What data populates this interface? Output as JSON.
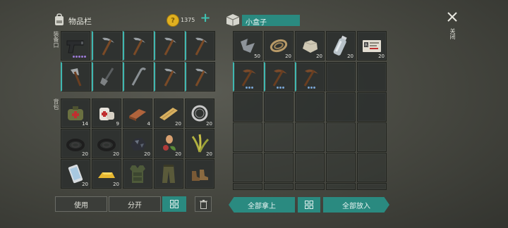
{
  "inventory": {
    "title": "物品栏",
    "coin_count": "1375",
    "add_label": "+",
    "section_equip": "装备口",
    "section_backpack": "背包",
    "equip_slots": [
      {
        "icon": "pistol-icon",
        "count": ""
      },
      {
        "icon": "pickaxe-icon",
        "count": ""
      },
      {
        "icon": "pickaxe-icon",
        "count": ""
      },
      {
        "icon": "pickaxe-icon",
        "count": ""
      },
      {
        "icon": "pickaxe-icon",
        "count": ""
      },
      {
        "icon": "hatchet-icon",
        "count": ""
      },
      {
        "icon": "shovel-icon",
        "count": ""
      },
      {
        "icon": "crowbar-icon",
        "count": ""
      },
      {
        "icon": "pickaxe-icon",
        "count": ""
      },
      {
        "icon": "pickaxe-icon",
        "count": ""
      }
    ],
    "backpack_slots": [
      {
        "icon": "medkit-bag-icon",
        "count": "14"
      },
      {
        "icon": "bandage-icon",
        "count": "9"
      },
      {
        "icon": "copper-bar-icon",
        "count": "4"
      },
      {
        "icon": "plank-icon",
        "count": "20"
      },
      {
        "icon": "wire-coil-icon",
        "count": "20"
      },
      {
        "icon": "rope-coil-icon",
        "count": "20"
      },
      {
        "icon": "rope-coil-icon",
        "count": "20"
      },
      {
        "icon": "ore-icon",
        "count": "20"
      },
      {
        "icon": "seeds-icon",
        "count": "20"
      },
      {
        "icon": "plant-fiber-icon",
        "count": "20"
      },
      {
        "icon": "smartphone-icon",
        "count": "20"
      },
      {
        "icon": "gold-bar-icon",
        "count": "20"
      },
      {
        "icon": "body-armor-icon",
        "count": ""
      },
      {
        "icon": "pants-icon",
        "count": ""
      },
      {
        "icon": "boots-icon",
        "count": ""
      }
    ],
    "use_label": "使用",
    "split_label": "分开"
  },
  "container": {
    "title": "小盒子",
    "top_row": [
      {
        "icon": "scrap-metal-icon",
        "count": "50"
      },
      {
        "icon": "rope-icon",
        "count": "20"
      },
      {
        "icon": "stone-icon",
        "count": "20"
      },
      {
        "icon": "water-bottle-icon",
        "count": "20"
      },
      {
        "icon": "id-card-icon",
        "count": "20"
      }
    ],
    "second_row": [
      {
        "icon": "pickaxe-icon",
        "count": ""
      },
      {
        "icon": "pickaxe-icon",
        "count": ""
      },
      {
        "icon": "pickaxe-icon",
        "count": ""
      }
    ],
    "take_all_label": "全部拿上",
    "put_all_label": "全部放入"
  },
  "close": {
    "label": "关闭"
  },
  "colors": {
    "accent": "#2a8a80",
    "coin": "#e0b020",
    "durability": "#7aa6d6"
  }
}
